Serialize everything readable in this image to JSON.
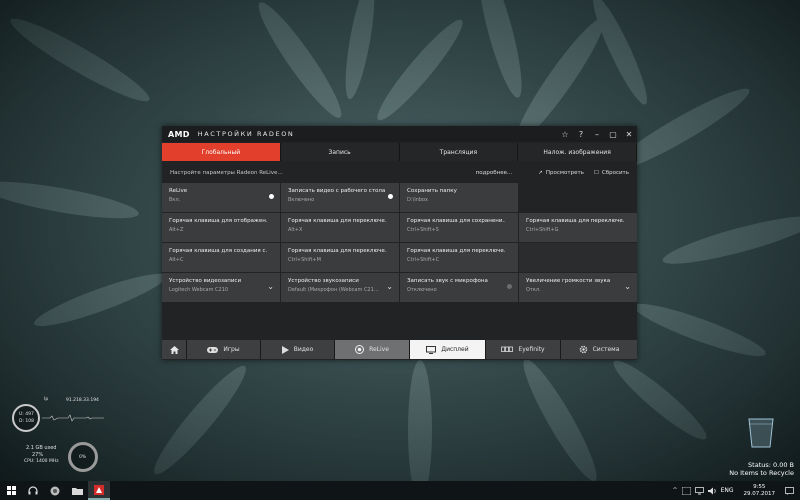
{
  "window": {
    "brand": "AMD",
    "title": "НАСТРОЙКИ RADEON"
  },
  "tabs": [
    "Глобальный",
    "Запись",
    "Трансляция",
    "Налож. изображения"
  ],
  "info": {
    "text": "Настройте параметры Radeon ReLive...",
    "more": "подробнее...",
    "view": "Просмотреть",
    "reset": "Сбросить"
  },
  "tiles": {
    "relive": {
      "title": "ReLive",
      "value": "Вкл."
    },
    "record_desktop": {
      "title": "Записать видео с рабочего стола",
      "value": "Включено"
    },
    "save_folder": {
      "title": "Сохранить папку",
      "value": "D:\\Inbox"
    },
    "hk_show": {
      "title": "Горячая клавиша для отображен...",
      "value": "Alt+Z"
    },
    "hk_switch1": {
      "title": "Горячая клавиша для переключе...",
      "value": "Alt+X"
    },
    "hk_save": {
      "title": "Горячая клавиша для сохранени...",
      "value": "Ctrl+Shift+S"
    },
    "hk_switch2": {
      "title": "Горячая клавиша для переключе...",
      "value": "Ctrl+Shift+G"
    },
    "hk_create": {
      "title": "Горячая клавиша для создания с...",
      "value": "Alt+C"
    },
    "hk_switch3": {
      "title": "Горячая клавиша для переключе...",
      "value": "Ctrl+Shift+M"
    },
    "hk_switch4": {
      "title": "Горячая клавиша для переключе...",
      "value": "Ctrl+Shift+C"
    },
    "video_device": {
      "title": "Устройство видеозаписи",
      "value": "Logitech Webcam C210"
    },
    "audio_device": {
      "title": "Устройство звукозаписи",
      "value": "Default (Микрофон (Webcam C21..."
    },
    "mic_record": {
      "title": "Записать звук с микрофона",
      "value": "Отключено"
    },
    "volume_boost": {
      "title": "Увеличение громкости звука",
      "value": "Откл."
    }
  },
  "bottom_nav": {
    "games": "Игры",
    "video": "Видео",
    "relive": "ReLive",
    "display": "Дисплей",
    "eyefinity": "Eyefinity",
    "system": "Система"
  },
  "gadget": {
    "ip": "91.218.33.194",
    "upload": "U: 497",
    "download": "D: 108",
    "used": "2.1 GB used",
    "cpu_pct": "27%",
    "cpu_freq": "CPU: 1400 MHz",
    "gauge": "0%",
    "net": "Ip"
  },
  "recycle": {
    "status": "Status: 0.00 B",
    "items": "No Items to Recycle"
  },
  "taskbar": {
    "lang": "ENG",
    "time": "9:55",
    "date": "29.07.2017"
  },
  "colors": {
    "accent": "#e2402d",
    "tile": "#3b3c3e"
  }
}
